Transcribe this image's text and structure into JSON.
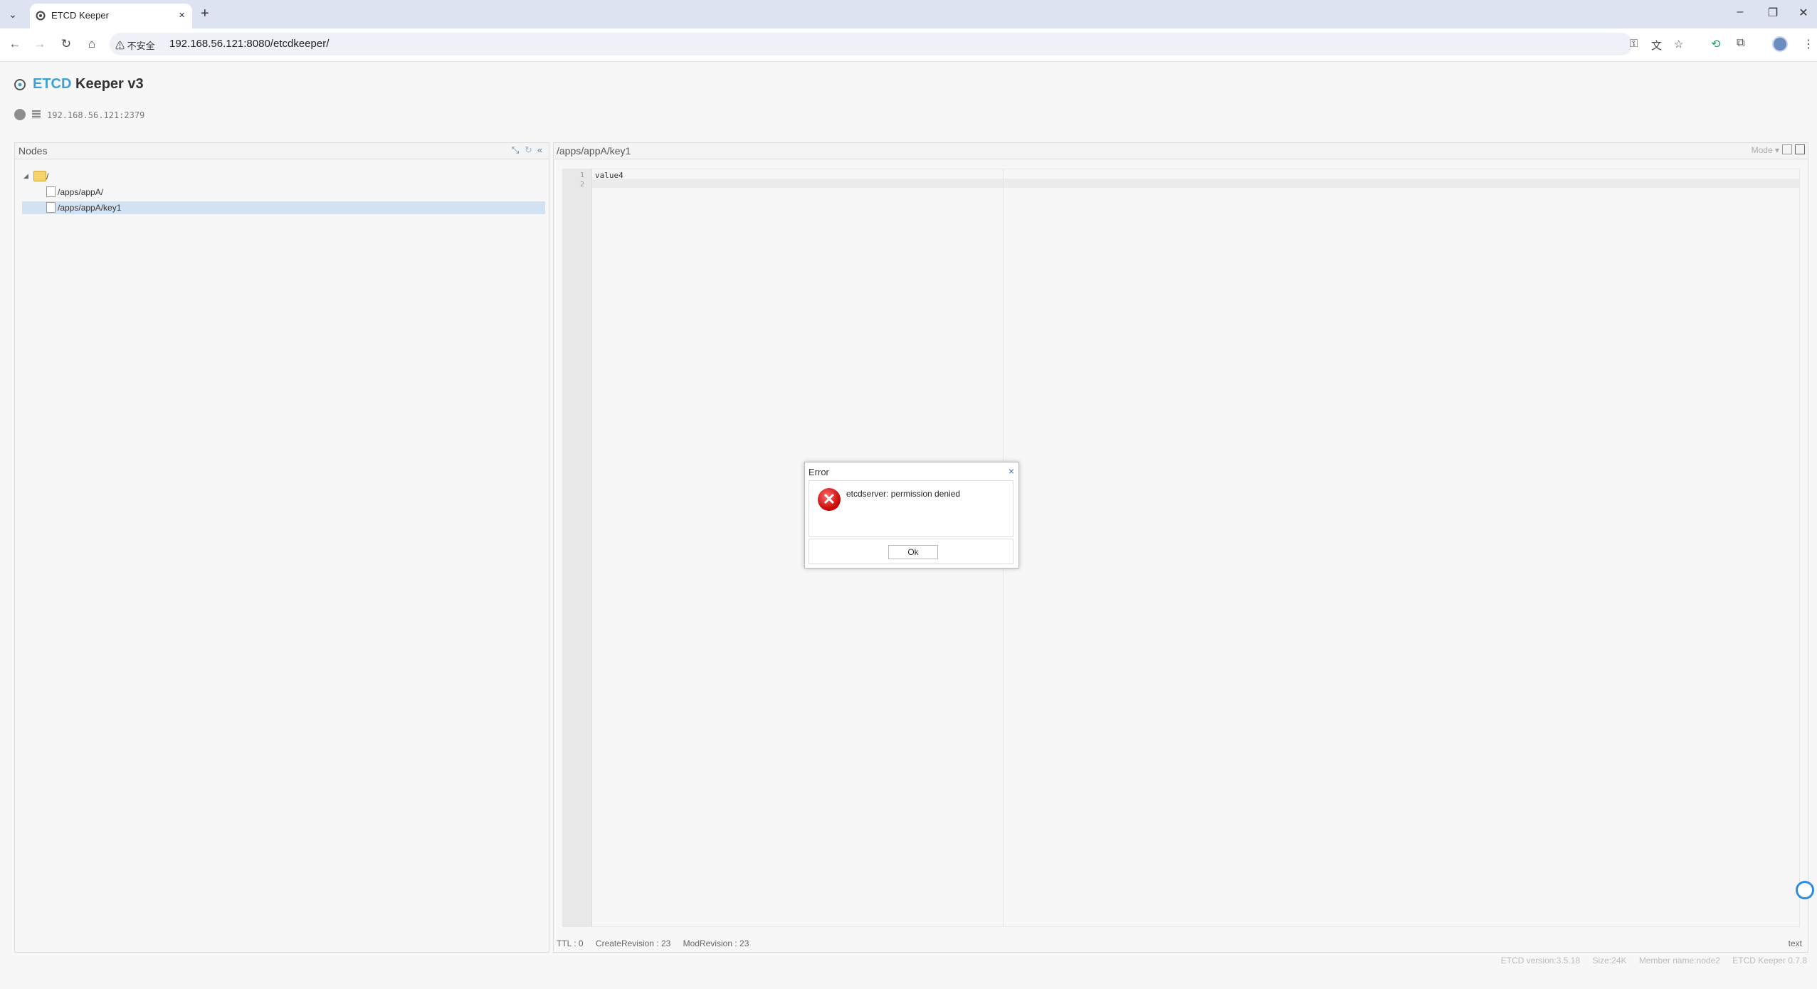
{
  "browser": {
    "tab_title": "ETCD Keeper",
    "tab_close": "×",
    "new_tab": "+",
    "insecure_label": "不安全",
    "url": "192.168.56.121:8080/etcdkeeper/"
  },
  "app": {
    "title_etcd": "ETCD",
    "title_rest": " Keeper v3",
    "host": "192.168.56.121:2379"
  },
  "nodes_panel": {
    "title": "Nodes",
    "tree": {
      "root": "/",
      "items": [
        "/apps/appA/",
        "/apps/appA/key1"
      ]
    }
  },
  "editor": {
    "path": "/apps/appA/key1",
    "mode_label": "Mode",
    "lines": [
      "value4",
      ""
    ],
    "line_numbers": [
      "1",
      "2"
    ],
    "status": {
      "ttl": "TTL : 0",
      "create_revision": "CreateRevision : 23",
      "mod_revision": "ModRevision : 23"
    },
    "language": "text"
  },
  "footer": {
    "etcd_version": "ETCD version:3.5.18",
    "size": "Size:24K",
    "member": "Member name:node2",
    "keeper_version": "ETCD Keeper 0.7.8"
  },
  "dialog": {
    "title": "Error",
    "close": "×",
    "icon_glyph": "✕",
    "message": "etcdserver: permission denied",
    "ok_label": "Ok"
  },
  "colors": {
    "accent": "#3fa0d6",
    "selection": "#d3e2f3",
    "error": "#c40000"
  }
}
